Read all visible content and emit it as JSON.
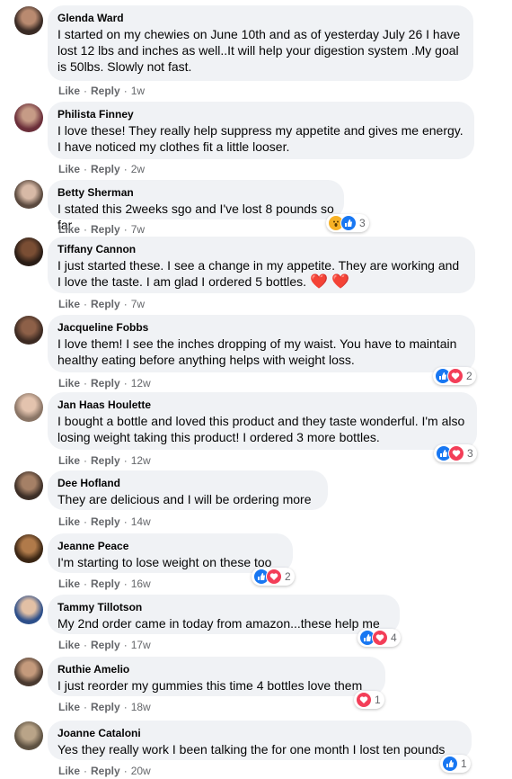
{
  "comments": [
    {
      "author": "Glenda Ward",
      "text": "I started on my chewies on June 10th and as of yesterday July 26 I have lost 12 lbs and inches as well..It will help your digestion system .My goal is 50lbs. Slowly not fast.",
      "like": "Like",
      "reply": "Reply",
      "time": "1w",
      "reaction_count": ""
    },
    {
      "author": "Philista Finney",
      "text": "I love these! They really help suppress my appetite and gives me energy. I have noticed my clothes fit a little looser.",
      "like": "Like",
      "reply": "Reply",
      "time": "2w",
      "reaction_count": ""
    },
    {
      "author": "Betty Sherman",
      "text": "I stated this 2weeks sgo and I've lost 8 pounds so far",
      "like": "Like",
      "reply": "Reply",
      "time": "7w",
      "reaction_count": "3"
    },
    {
      "author": "Tiffany Cannon",
      "text": "I just started these. I see a change in my appetite. They are working and I love the taste. I am glad I ordered 5 bottles.",
      "like": "Like",
      "reply": "Reply",
      "time": "7w",
      "reaction_count": ""
    },
    {
      "author": "Jacqueline Fobbs",
      "text": "I love them! I see the inches dropping of my waist. You have to maintain healthy eating before anything helps with weight loss.",
      "like": "Like",
      "reply": "Reply",
      "time": "12w",
      "reaction_count": "2"
    },
    {
      "author": "Jan Haas Houlette",
      "text": "I bought a bottle and loved this product and they taste wonderful. I'm also losing weight taking this product! I ordered 3 more bottles.",
      "like": "Like",
      "reply": "Reply",
      "time": "12w",
      "reaction_count": "3"
    },
    {
      "author": "Dee Hofland",
      "text": "They are delicious and I will be ordering more",
      "like": "Like",
      "reply": "Reply",
      "time": "14w",
      "reaction_count": ""
    },
    {
      "author": "Jeanne Peace",
      "text": "I'm starting to lose weight on these too",
      "like": "Like",
      "reply": "Reply",
      "time": "16w",
      "reaction_count": "2"
    },
    {
      "author": "Tammy Tillotson",
      "text": "My 2nd order came in today from amazon...these help me",
      "like": "Like",
      "reply": "Reply",
      "time": "17w",
      "reaction_count": "4"
    },
    {
      "author": "Ruthie Amelio",
      "text": "I just reorder my gummies this time 4 bottles love them",
      "like": "Like",
      "reply": "Reply",
      "time": "18w",
      "reaction_count": "1"
    },
    {
      "author": "Joanne Cataloni",
      "text": "Yes they really work I been talking the for one month I lost ten pounds",
      "like": "Like",
      "reply": "Reply",
      "time": "20w",
      "reaction_count": "1"
    }
  ],
  "dot": "·",
  "hearts_emoji": "❤️ ❤️",
  "colors": {
    "bubble": "#f0f2f5",
    "like_blue": "#1877f2",
    "love_red": "#f33e58",
    "wow_yellow": "#f7b125",
    "meta_gray": "#65676b"
  }
}
